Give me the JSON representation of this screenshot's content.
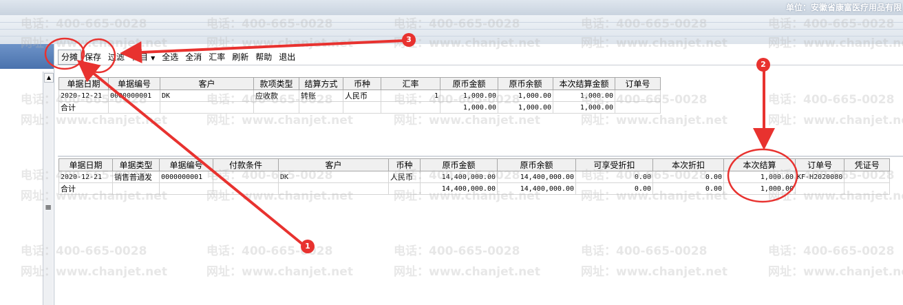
{
  "header": {
    "unit_label": "单位：安徽省康富医疗用品有限"
  },
  "watermark": {
    "phone": "电话：400-665-0028",
    "site": "网址：www.chanjet.net"
  },
  "toolbar": {
    "buttons": [
      {
        "label": "分摊"
      },
      {
        "label": "保存"
      },
      {
        "label": "过滤"
      },
      {
        "label": "栏目"
      },
      {
        "label": "全选"
      },
      {
        "label": "全消"
      },
      {
        "label": "汇率"
      },
      {
        "label": "刷新"
      },
      {
        "label": "帮助"
      },
      {
        "label": "退出"
      }
    ]
  },
  "grid1": {
    "headers": [
      "单据日期",
      "单据编号",
      "客户",
      "款项类型",
      "结算方式",
      "币种",
      "汇率",
      "原币金额",
      "原币余额",
      "本次结算金额",
      "订单号"
    ],
    "rows": [
      [
        "2020-12-21",
        "0000000001",
        "DK",
        "应收款",
        "转账",
        "人民币",
        "1",
        "1,000.00",
        "1,000.00",
        "1,000.00",
        ""
      ],
      [
        "合计",
        "",
        "",
        "",
        "",
        "",
        "",
        "1,000.00",
        "1,000.00",
        "1,000.00",
        ""
      ]
    ]
  },
  "grid2": {
    "headers": [
      "单据日期",
      "单据类型",
      "单据编号",
      "付款条件",
      "客户",
      "币种",
      "原币金额",
      "原币余额",
      "可享受折扣",
      "本次折扣",
      "本次结算",
      "订单号",
      "凭证号"
    ],
    "rows": [
      [
        "2020-12-21",
        "销售普通发",
        "0000000001",
        "",
        "DK",
        "人民币",
        "14,400,000.00",
        "14,400,000.00",
        "0.00",
        "0.00",
        "1,000.00",
        "KF-H2020080",
        ""
      ],
      [
        "合计",
        "",
        "",
        "",
        "",
        "",
        "14,400,000.00",
        "14,400,000.00",
        "0.00",
        "0.00",
        "1,000.00",
        "",
        ""
      ]
    ]
  },
  "annotations": {
    "badges": [
      "1",
      "2",
      "3"
    ],
    "color": "#e8322f"
  },
  "icons": {
    "scroll_up": "up-arrow-icon",
    "splitter_grip": "grip-icon",
    "dropdown": "triangle-down-icon"
  }
}
